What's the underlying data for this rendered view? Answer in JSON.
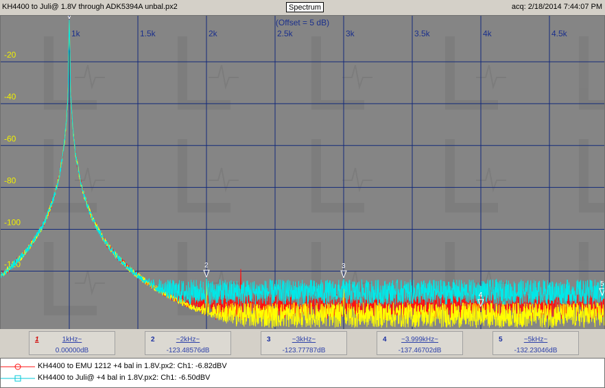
{
  "titlebar": {
    "left_title": "KH4400 to Juli@ 1.8V through ADK5394A unbal.px2",
    "center_button": "Spectrum",
    "right_text": "acq: 2/18/2014 7:44:07 PM"
  },
  "chart_data": {
    "type": "line",
    "title": "",
    "annotation": "(Offset = 5 dB)",
    "xlabel": "",
    "ylabel": "",
    "x_unit": "Hz",
    "xlim": [
      500,
      4900
    ],
    "ylim": [
      -148,
      2
    ],
    "x_ticks": [
      {
        "value": 1000,
        "label": "1k"
      },
      {
        "value": 1500,
        "label": "1.5k"
      },
      {
        "value": 2000,
        "label": "2k"
      },
      {
        "value": 2500,
        "label": "2.5k"
      },
      {
        "value": 3000,
        "label": "3k"
      },
      {
        "value": 3500,
        "label": "3.5k"
      },
      {
        "value": 4000,
        "label": "4k"
      },
      {
        "value": 4500,
        "label": "4.5k"
      }
    ],
    "y_ticks": [
      {
        "value": -20,
        "label": "-20"
      },
      {
        "value": -40,
        "label": "-40"
      },
      {
        "value": -60,
        "label": "-60"
      },
      {
        "value": -80,
        "label": "-80"
      },
      {
        "value": -100,
        "label": "-100"
      },
      {
        "value": -120,
        "label": "-120"
      }
    ],
    "grid": true,
    "background_color": "#858585",
    "grid_color": "#12297a",
    "axis_label_color": "#1a2f8c",
    "y_label_color": "#f0f000",
    "series": [
      {
        "name": "KH4400 to EMU 1212 +4 bal in 1.8V.px2:  Ch1: -6.82dBV",
        "color": "#ff1010",
        "legend_symbol": "circle",
        "noise_floor_db": -137,
        "noise_floor_at_start_db": -130,
        "peaks": [
          {
            "x": 1000,
            "y": 0
          },
          {
            "x": 2000,
            "y": -123.5
          },
          {
            "x": 2250,
            "y": -119
          },
          {
            "x": 3000,
            "y": -123.8
          }
        ]
      },
      {
        "name": "KH4400 to Juli@ +4 bal in 1.8V.px2:  Ch1: -6.50dBV",
        "color": "#00e8e8",
        "legend_symbol": "square",
        "noise_floor_db": -130,
        "noise_floor_at_start_db": -128,
        "peaks": [
          {
            "x": 1000,
            "y": 0
          },
          {
            "x": 2000,
            "y": -123.5
          },
          {
            "x": 3000,
            "y": -123.8
          }
        ]
      },
      {
        "name": "",
        "color": "#ffff00",
        "legend_symbol": "none",
        "noise_floor_db": -141,
        "noise_floor_at_start_db": -133,
        "peaks": [
          {
            "x": 1000,
            "y": 0
          },
          {
            "x": 2000,
            "y": -123.5
          },
          {
            "x": 3000,
            "y": -123.8
          }
        ]
      }
    ],
    "markers": [
      {
        "num": "1",
        "x": 1000,
        "y": 0,
        "freq_label": "1kHz~",
        "value_label": "0.00000dB"
      },
      {
        "num": "2",
        "x": 2000,
        "y": -123.48576,
        "freq_label": "~2kHz~",
        "value_label": "-123.48576dB"
      },
      {
        "num": "3",
        "x": 3000,
        "y": -123.77787,
        "freq_label": "~3kHz~",
        "value_label": "-123.77787dB"
      },
      {
        "num": "4",
        "x": 3999,
        "y": -137.46702,
        "freq_label": "~3.999kHz~",
        "value_label": "-137.46702dB"
      },
      {
        "num": "5",
        "x": 5000,
        "y": -132.23046,
        "freq_label": "~5kHz~",
        "value_label": "-132.23046dB"
      }
    ]
  },
  "legend": [
    {
      "text": "KH4400 to EMU 1212 +4 bal in 1.8V.px2:  Ch1: -6.82dBV",
      "color": "#ff1010",
      "symbol": "circle"
    },
    {
      "text": "KH4400 to Juli@ +4 bal in 1.8V.px2:  Ch1: -6.50dBV",
      "color": "#00e8e8",
      "symbol": "square"
    }
  ]
}
